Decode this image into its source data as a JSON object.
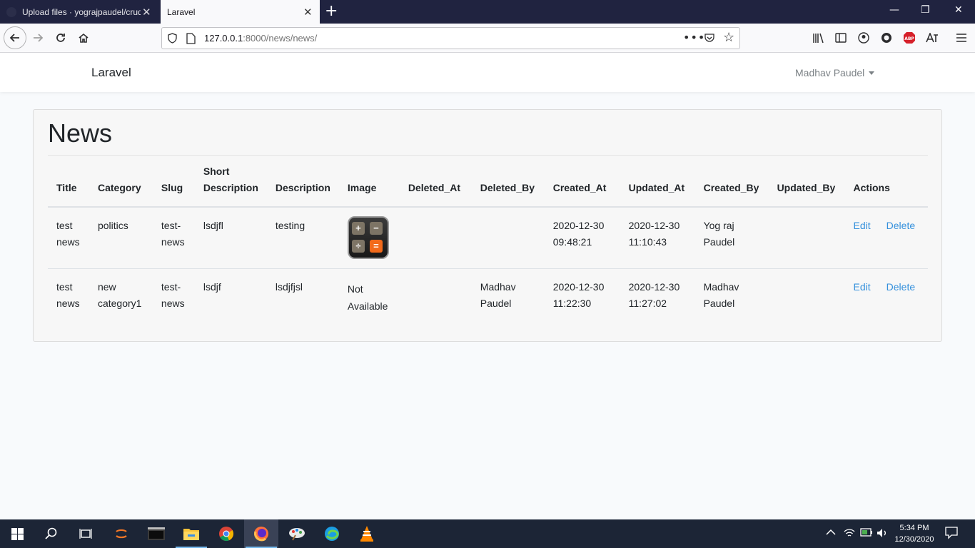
{
  "browser": {
    "tabs": [
      {
        "title": "Upload files · yograjpaudel/crud-ope"
      },
      {
        "title": "Laravel"
      }
    ],
    "new_tab_symbol": "+",
    "close_symbol": "✕",
    "window_controls": {
      "minimize": "—",
      "restore": "❐",
      "close": "✕"
    },
    "url": {
      "host": "127.0.0.1",
      "rest": ":8000/news/news/"
    }
  },
  "app": {
    "brand": "Laravel",
    "user_name": "Madhav Paudel"
  },
  "page": {
    "title": "News",
    "columns": [
      "Title",
      "Category",
      "Slug",
      "Short Description",
      "Description",
      "Image",
      "Deleted_At",
      "Deleted_By",
      "Created_At",
      "Updated_At",
      "Created_By",
      "Updated_By",
      "Actions"
    ],
    "rows": [
      {
        "title": "test news",
        "category": "politics",
        "slug": "test-news",
        "short_description": "lsdjfl",
        "description": "testing",
        "image": "calculator-icon",
        "deleted_at": "",
        "deleted_by": "",
        "created_at": "2020-12-30 09:48:21",
        "updated_at": "2020-12-30 11:10:43",
        "created_by": "Yog raj Paudel",
        "updated_by": "",
        "edit": "Edit",
        "delete": "Delete"
      },
      {
        "title": "test news",
        "category": "new category1",
        "slug": "test-news",
        "short_description": "lsdjf",
        "description": "lsdjfjsl",
        "image_text": "Not Available",
        "deleted_at": "",
        "deleted_by": "Madhav Paudel",
        "created_at": "2020-12-30 11:22:30",
        "updated_at": "2020-12-30 11:27:02",
        "created_by": "Madhav Paudel",
        "updated_by": "",
        "edit": "Edit",
        "delete": "Delete"
      }
    ]
  },
  "taskbar": {
    "time": "5:34 PM",
    "date": "12/30/2020"
  },
  "colors": {
    "link": "#3490dc",
    "tabbar": "#202340",
    "taskbar": "#1c2536"
  }
}
